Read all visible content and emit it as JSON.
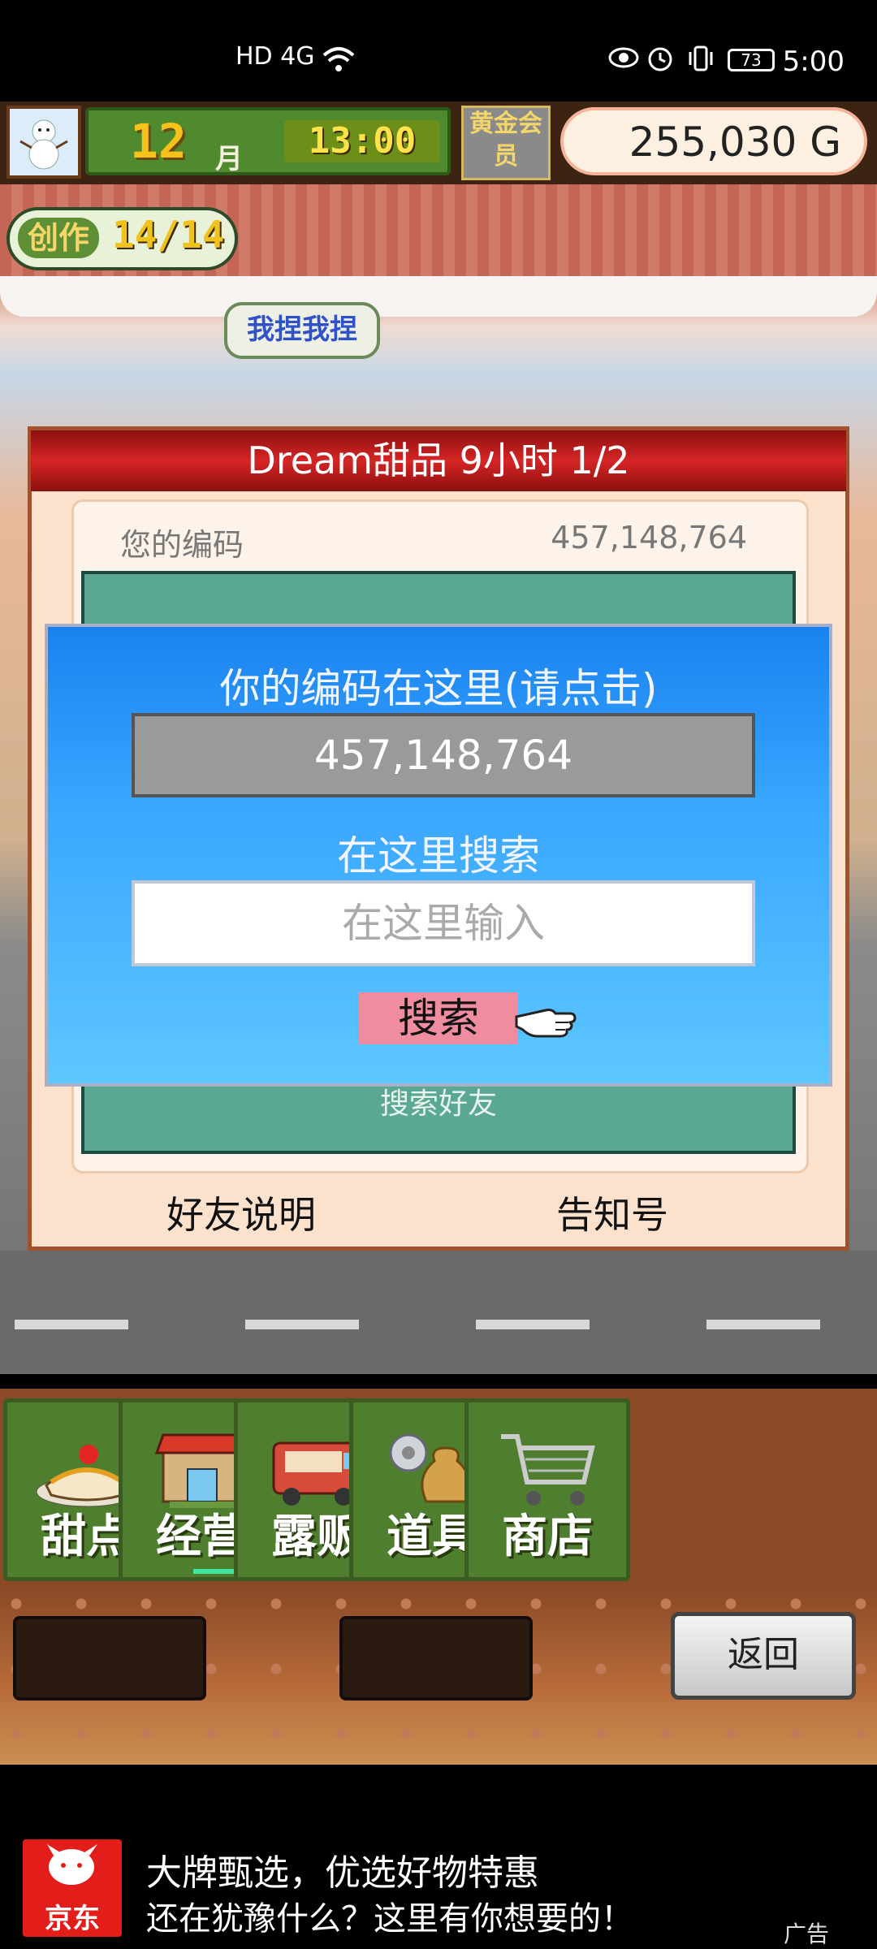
{
  "status_bar": {
    "network": "HD 4G",
    "battery": "73",
    "time": "5:00"
  },
  "hud": {
    "month_number": "12",
    "month_unit": "月",
    "clock": "13:00",
    "member_badge": "黄金会员",
    "money": "255,030 G"
  },
  "scene": {
    "create_label": "创作",
    "create_count": "14/14",
    "speech_bubble": "我捏我捏"
  },
  "panel": {
    "title": "Dream甜品  9小时 1/2",
    "code_label": "您的编码",
    "code_value": "457,148,764",
    "search_friend": "搜索好友",
    "friend_help": "好友说明",
    "notice_number": "告知号"
  },
  "dialog": {
    "title": "你的编码在这里(请点击)",
    "code": "457,148,764",
    "search_label": "在这里搜索",
    "input_placeholder": "在这里输入",
    "search_button": "搜索"
  },
  "menu": {
    "items": [
      {
        "label": "甜点",
        "icon": "cake-icon"
      },
      {
        "label": "经营",
        "icon": "shop-icon"
      },
      {
        "label": "露贩",
        "icon": "food-truck-icon"
      },
      {
        "label": "道具",
        "icon": "items-bag-icon"
      },
      {
        "label": "商店",
        "icon": "cart-icon"
      }
    ]
  },
  "back_button": "返回",
  "ad": {
    "brand": "京东",
    "line1": "大牌甄选，优选好物特惠",
    "line2": "还在犹豫什么？这里有你想要的！",
    "tag": "广告"
  },
  "colors": {
    "panel_title_red": "#d62525",
    "dialog_blue": "#3aa7ff",
    "menu_green": "#4f7f2e",
    "search_button_pink": "#f08ca0"
  }
}
